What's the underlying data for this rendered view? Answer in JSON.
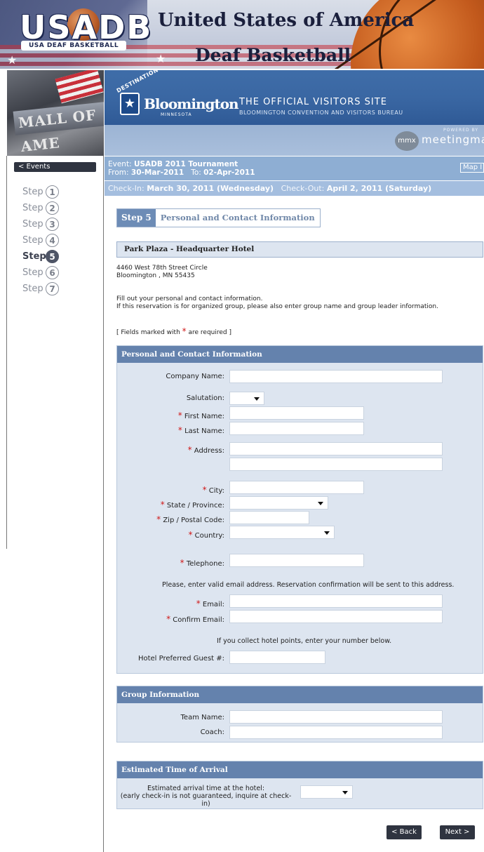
{
  "banner": {
    "logo_text": "USADB",
    "logo_sub": "USA DEAF BASKETBALL",
    "title_line1": "United States of America",
    "title_line2": "Deaf Basketball"
  },
  "left_photo_sign": "MALL OF AME",
  "sidebar": {
    "events_button": "< Events",
    "steps": [
      {
        "label": "Step",
        "num": "1",
        "active": false
      },
      {
        "label": "Step",
        "num": "2",
        "active": false
      },
      {
        "label": "Step",
        "num": "3",
        "active": false
      },
      {
        "label": "Step",
        "num": "4",
        "active": false
      },
      {
        "label": "Step",
        "num": "5",
        "active": true
      },
      {
        "label": "Step",
        "num": "6",
        "active": false
      },
      {
        "label": "Step",
        "num": "7",
        "active": false
      }
    ]
  },
  "header": {
    "destination": "DESTINATION",
    "brand": "Bloomington",
    "brand_state": "MINNESOTA",
    "official": "THE OFFICIAL VISITORS SITE",
    "bureau": "BLOOMINGTON CONVENTION AND VISITORS BUREAU",
    "powered_by": "POWERED BY",
    "mmx": "mmx",
    "meetingmatrix": "meetingma"
  },
  "event": {
    "event_label": "Event:",
    "event_name": "USADB 2011 Tournament",
    "from_label": "From:",
    "from_date": "30-Mar-2011",
    "to_label": "To:",
    "to_date": "02-Apr-2011",
    "map_button": "Map I",
    "checkin_label": "Check-In:",
    "checkin_date": "March 30, 2011 (Wednesday)",
    "checkout_label": "Check-Out:",
    "checkout_date": "April 2, 2011 (Saturday)"
  },
  "step5": {
    "num": "Step 5",
    "title": "Personal and Contact Information"
  },
  "hotel": {
    "name": "Park Plaza - Headquarter Hotel",
    "address_line1": "4460 West 78th Street Circle",
    "address_line2": "Bloomington , MN 55435"
  },
  "instructions": {
    "line1": "Fill out your personal and contact information.",
    "line2": "If this reservation is for organized group, please also enter group name and group leader information.",
    "required_prefix": "[ Fields marked with ",
    "required_star": "*",
    "required_suffix": " are required ]"
  },
  "personal": {
    "header": "Personal and Contact Information",
    "company_label": "Company Name:",
    "salutation_label": "Salutation:",
    "first_name_label": "First Name:",
    "last_name_label": "Last Name:",
    "address_label": "Address:",
    "city_label": "City:",
    "state_label": "State / Province:",
    "zip_label": "Zip / Postal Code:",
    "country_label": "Country:",
    "telephone_label": "Telephone:",
    "email_note": "Please, enter valid email address.  Reservation confirmation will be sent to this address.",
    "email_label": "Email:",
    "confirm_email_label": "Confirm Email:",
    "points_note": "If you collect hotel points, enter your number below.",
    "guest_label": "Hotel Preferred Guest #:",
    "star": "*"
  },
  "group": {
    "header": "Group Information",
    "team_label": "Team Name:",
    "coach_label": "Coach:"
  },
  "arrival": {
    "header": "Estimated Time of Arrival",
    "line1": "Estimated arrival time at the hotel:",
    "line2": "(early check-in is not guaranteed, inquire at check-in)"
  },
  "nav": {
    "back": "< Back",
    "next": "Next >"
  }
}
